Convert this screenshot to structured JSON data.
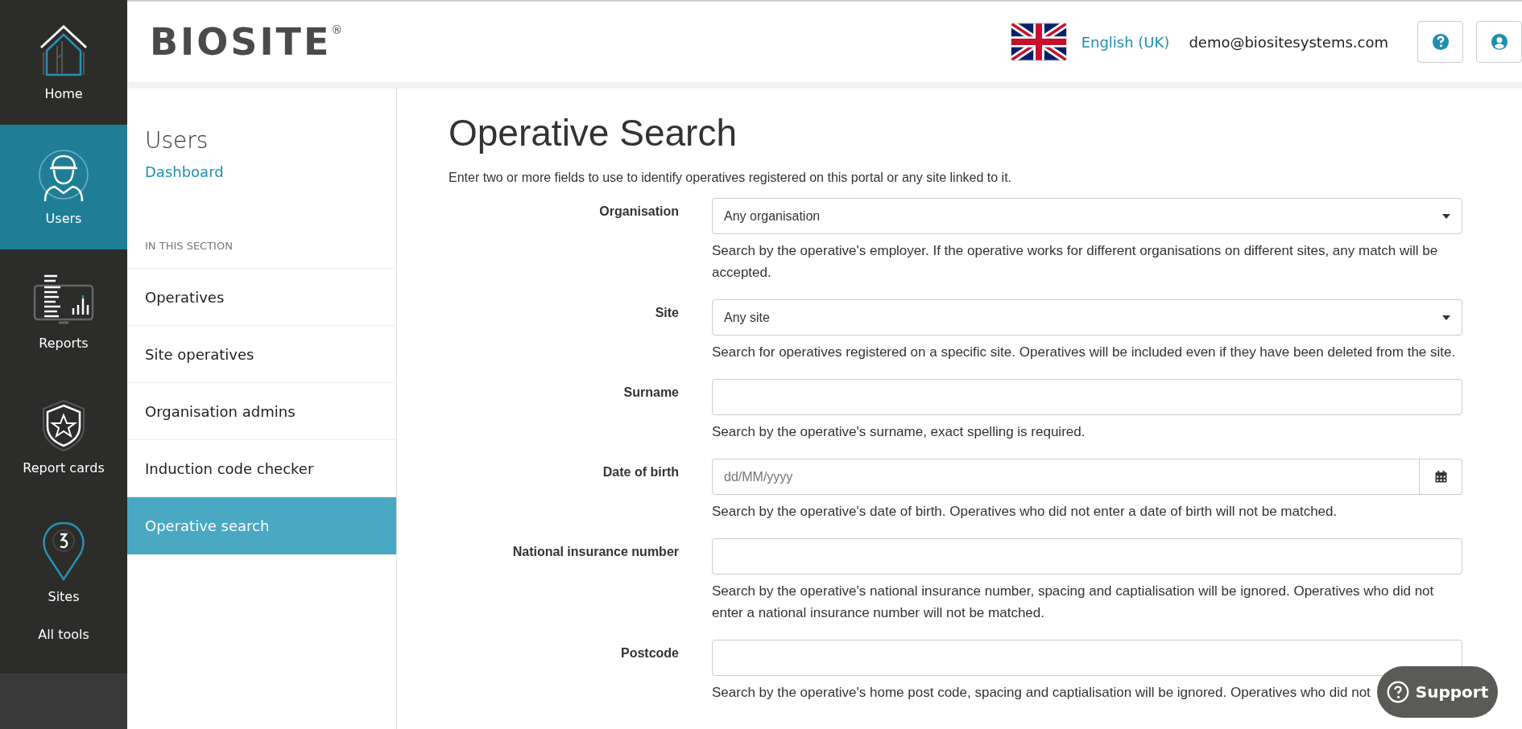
{
  "nav": [
    {
      "label": "Home",
      "selected": false
    },
    {
      "label": "Users",
      "selected": true
    },
    {
      "label": "Reports",
      "selected": false
    },
    {
      "label": "Report cards",
      "selected": false
    },
    {
      "label": "Sites",
      "selected": false
    },
    {
      "label": "All tools",
      "selected": false
    }
  ],
  "header": {
    "logo": "BIOSITE",
    "logo_mark": "®",
    "language": "English (UK)",
    "email": "demo@biositesystems.com"
  },
  "sidebar": {
    "title": "Users",
    "link": "Dashboard",
    "section_label": "IN THIS SECTION",
    "items": [
      {
        "label": "Operatives",
        "selected": false
      },
      {
        "label": "Site operatives",
        "selected": false
      },
      {
        "label": "Organisation admins",
        "selected": false
      },
      {
        "label": "Induction code checker",
        "selected": false
      },
      {
        "label": "Operative search",
        "selected": true
      }
    ]
  },
  "main": {
    "title": "Operative Search",
    "intro": "Enter two or more fields to use to identify operatives registered on this portal or any site linked to it.",
    "fields": [
      {
        "label": "Organisation",
        "kind": "select",
        "value": "Any organisation",
        "help": "Search by the operative's employer. If the operative works for different organisations on different sites, any match will be accepted."
      },
      {
        "label": "Site",
        "kind": "select",
        "value": "Any site",
        "help": "Search for operatives registered on a specific site. Operatives will be included even if they have been deleted from the site."
      },
      {
        "label": "Surname",
        "kind": "text",
        "help": "Search by the operative's surname, exact spelling is required."
      },
      {
        "label": "Date of birth",
        "kind": "date",
        "placeholder": "dd/MM/yyyy",
        "help": "Search by the operative's date of birth. Operatives who did not enter a date of birth will not be matched."
      },
      {
        "label": "National insurance number",
        "kind": "text",
        "help": "Search by the operative's national insurance number, spacing and captialisation will be ignored. Operatives who did not enter a national insurance number will not be matched."
      },
      {
        "label": "Postcode",
        "kind": "text",
        "help": "Search by the operative's home post code, spacing and captialisation will be ignored. Operatives who did not"
      }
    ]
  },
  "support": {
    "label": "Support"
  }
}
